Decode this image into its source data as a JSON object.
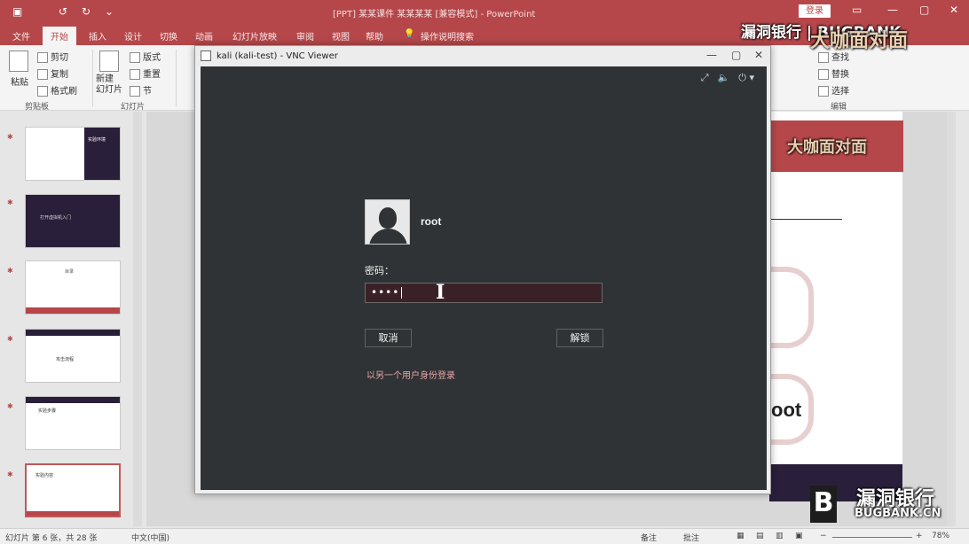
{
  "ppt": {
    "title_text": "[PPT] 某某课件 某某某某 [兼容模式] - PowerPoint",
    "login_label": "登录",
    "tabs": [
      "文件",
      "开始",
      "插入",
      "设计",
      "切换",
      "动画",
      "幻灯片放映",
      "审阅",
      "视图",
      "帮助",
      "操作说明搜索"
    ],
    "active_tab": "开始",
    "ribbon": {
      "paste": "粘贴",
      "cut": "剪切",
      "copy": "复制",
      "format_painter": "格式刷",
      "clipboard_group": "剪贴板",
      "new_slide": "新建\n幻灯片",
      "layout": "版式",
      "reset": "重置",
      "section": "节",
      "slides_group": "幻灯片",
      "find": "查找",
      "replace": "替换",
      "select": "选择",
      "edit_group": "编辑"
    },
    "slide_thumbs": [
      {
        "label": "实验环境"
      },
      {
        "label": "打开虚拟机入门"
      },
      {
        "label": "目录"
      },
      {
        "label": "攻击流程"
      },
      {
        "label": "实验步骤"
      },
      {
        "label": "实验内容"
      }
    ],
    "canvas_fragments": {
      "slide_title": "大咖面对面",
      "slide_word": "oot"
    },
    "status": {
      "slide_info": "幻灯片 第 6 张，共 28 张",
      "language": "中文(中国)",
      "notes": "备注",
      "comments": "批注",
      "zoom": "78%"
    }
  },
  "vnc": {
    "window_title": "kali (kali-test) - VNC Viewer",
    "username": "root",
    "password_label": "密码：",
    "password_masked": "••••",
    "cancel_label": "取消",
    "unlock_label": "解锁",
    "other_user_link": "以另一个用户身份登录"
  },
  "watermark": {
    "top_text": "漏洞银行 | BUGBANK",
    "top_badge": "大咖面对面",
    "bottom_cn": "漏洞银行",
    "bottom_en": "BUGBANK.CN"
  },
  "colors": {
    "ppt_accent": "#b5474a",
    "gdm_bg": "#2f3335",
    "password_bg": "#3a2128",
    "link": "#e9a8a8"
  }
}
